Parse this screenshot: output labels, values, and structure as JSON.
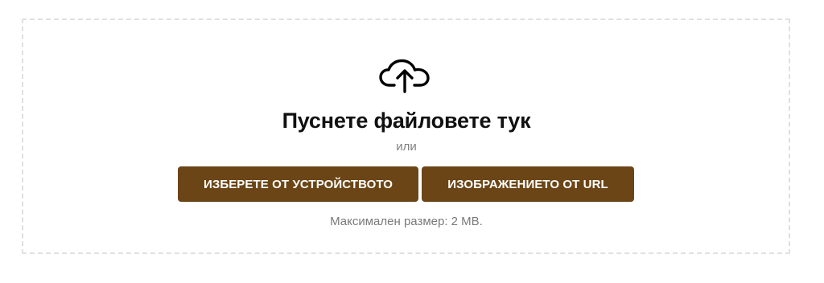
{
  "upload": {
    "icon": "cloud-upload-icon",
    "title": "Пуснете файловете тук",
    "or_text": "или",
    "device_button_label": "ИЗБЕРЕТЕ ОТ УСТРОЙСТВОТО",
    "url_button_label": "ИЗОБРАЖЕНИЕТО ОТ URL",
    "max_size_text": "Максимален размер: 2 MB."
  },
  "colors": {
    "button_background": "#6b4516",
    "button_text": "#ffffff",
    "dropzone_border": "#e0e0e0",
    "title_text": "#111111",
    "muted_text": "#808080"
  }
}
